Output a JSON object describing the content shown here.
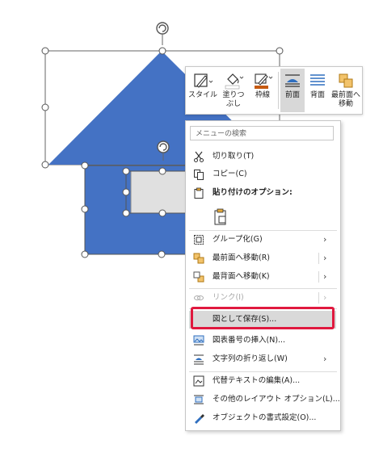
{
  "toolbar": {
    "style_label": "スタイル",
    "fill_label_1": "塗りつ",
    "fill_label_2": "ぶし",
    "outline_label": "枠線",
    "front_label": "前面",
    "back_label": "背面",
    "bring_front_label_1": "最前面へ",
    "bring_front_label_2": "移動"
  },
  "menu": {
    "search_placeholder": "メニューの検索",
    "cut": "切り取り(T)",
    "copy": "コピー(C)",
    "paste_options": "貼り付けのオプション:",
    "group": "グループ化(G)",
    "bring_to_front": "最前面へ移動(R)",
    "send_to_back": "最背面へ移動(K)",
    "link": "リンク(I)",
    "save_as_picture": "図として保存(S)...",
    "insert_caption": "図表番号の挿入(N)...",
    "wrap_text": "文字列の折り返し(W)",
    "edit_alt_text": "代替テキストの編集(A)...",
    "more_layout_options": "その他のレイアウト オプション(L)...",
    "format_object": "オブジェクトの書式設定(O)..."
  },
  "colors": {
    "shape_blue": "#4472c4",
    "highlight_red": "#e0193f",
    "outline_orange": "#c55a11"
  }
}
